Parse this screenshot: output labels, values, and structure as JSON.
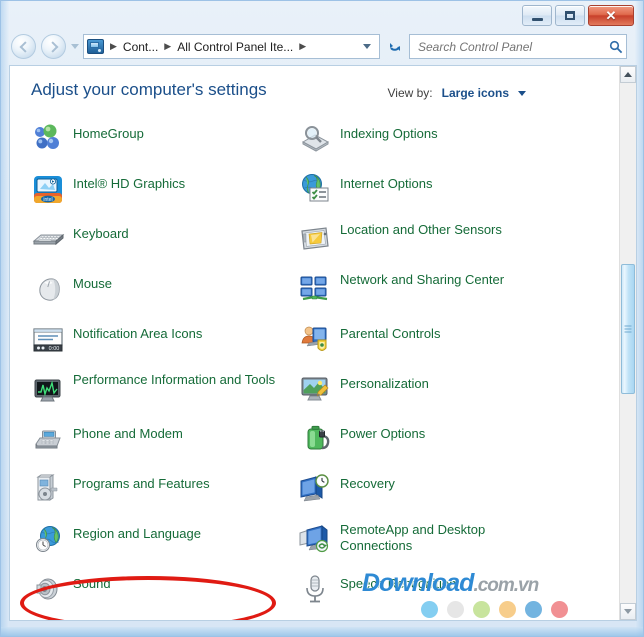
{
  "window": {
    "buttons": {
      "minimize": "Minimize",
      "maximize": "Maximize",
      "close": "✕"
    }
  },
  "navbar": {
    "back": "Back",
    "forward": "Forward",
    "history_label": "Recent pages",
    "breadcrumb": [
      {
        "label": "Cont...",
        "icon": "control-panel-icon"
      },
      {
        "label": "All Control Panel Ite..."
      }
    ],
    "separator": "▶",
    "refresh_label": "Refresh",
    "search": {
      "placeholder": "Search Control Panel",
      "value": "",
      "icon": "search-icon"
    }
  },
  "header": {
    "title": "Adjust your computer's settings",
    "view_by_label": "View by:",
    "view_by_value": "Large icons"
  },
  "items": {
    "left": [
      {
        "label": "HomeGroup",
        "icon": "homegroup-icon",
        "lines": 1
      },
      {
        "label": "Intel® HD Graphics",
        "icon": "intel-graphics-icon",
        "lines": 1
      },
      {
        "label": "Keyboard",
        "icon": "keyboard-icon",
        "lines": 1
      },
      {
        "label": "Mouse",
        "icon": "mouse-icon",
        "lines": 1
      },
      {
        "label": "Notification Area Icons",
        "icon": "notification-area-icon",
        "lines": 1
      },
      {
        "label": "Performance Information and Tools",
        "icon": "performance-icon",
        "lines": 2
      },
      {
        "label": "Phone and Modem",
        "icon": "phone-modem-icon",
        "lines": 1
      },
      {
        "label": "Programs and Features",
        "icon": "programs-features-icon",
        "lines": 1
      },
      {
        "label": "Region and Language",
        "icon": "region-language-icon",
        "lines": 1
      },
      {
        "label": "Sound",
        "icon": "sound-icon",
        "lines": 1
      }
    ],
    "right": [
      {
        "label": "Indexing Options",
        "icon": "indexing-options-icon",
        "lines": 1
      },
      {
        "label": "Internet Options",
        "icon": "internet-options-icon",
        "lines": 1
      },
      {
        "label": "Location and Other Sensors",
        "icon": "location-sensors-icon",
        "lines": 2
      },
      {
        "label": "Network and Sharing Center",
        "icon": "network-sharing-icon",
        "lines": 2
      },
      {
        "label": "Parental Controls",
        "icon": "parental-controls-icon",
        "lines": 1
      },
      {
        "label": "Personalization",
        "icon": "personalization-icon",
        "lines": 1
      },
      {
        "label": "Power Options",
        "icon": "power-options-icon",
        "lines": 1
      },
      {
        "label": "Recovery",
        "icon": "recovery-icon",
        "lines": 1
      },
      {
        "label": "RemoteApp and Desktop Connections",
        "icon": "remoteapp-icon",
        "lines": 2
      },
      {
        "label": "Speech Recognition",
        "icon": "speech-recognition-icon",
        "lines": 1
      }
    ]
  },
  "annotation": {
    "target": "Region and Language",
    "color": "#e01b13",
    "shape": "ellipse"
  },
  "watermark": {
    "main": "Download",
    "sub": ".com.vn",
    "main_color": "#2e8ad4",
    "sub_color": "#9aa2a8",
    "dots": [
      "#6ec6ef",
      "#e2e2e2",
      "#bedf8c",
      "#f6c477",
      "#5ba7da",
      "#ef7d80"
    ]
  },
  "colors": {
    "item_label": "#156b38",
    "title": "#1b4f8a",
    "accent": "#1f6cb0"
  }
}
